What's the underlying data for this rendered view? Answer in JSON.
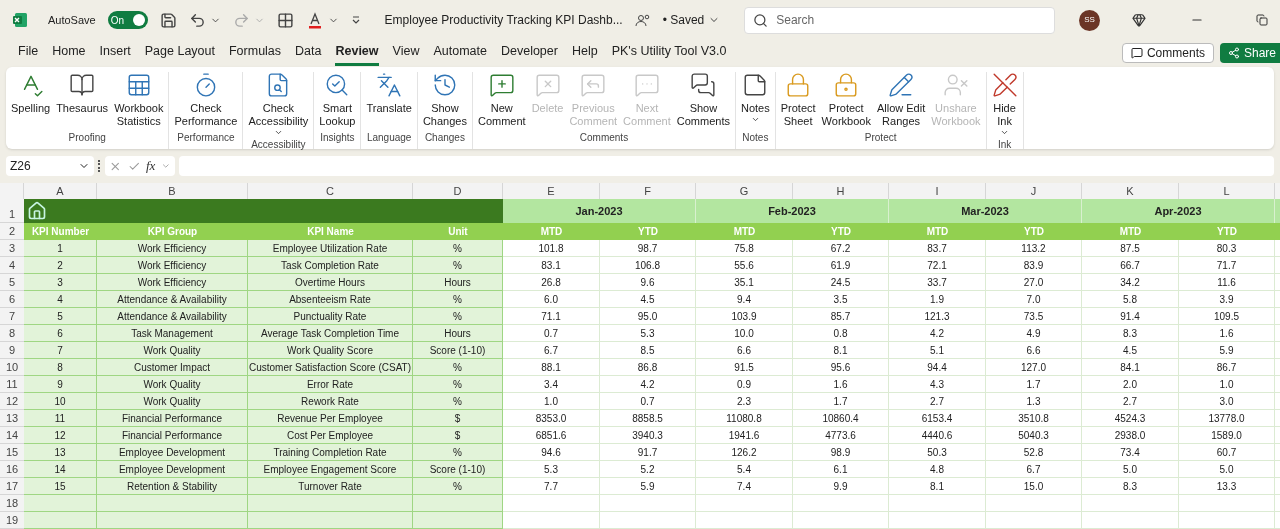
{
  "title_bar": {
    "autosave_label": "AutoSave",
    "autosave": {
      "on": true,
      "label": "On"
    },
    "document_title": "Employee Productivity Tracking KPI Dashb...",
    "save_status": "• Saved",
    "search_placeholder": "Search",
    "avatar_initials": "SS"
  },
  "menu": {
    "tabs": [
      {
        "label": "File",
        "selected": false
      },
      {
        "label": "Home",
        "selected": false
      },
      {
        "label": "Insert",
        "selected": false
      },
      {
        "label": "Page Layout",
        "selected": false
      },
      {
        "label": "Formulas",
        "selected": false
      },
      {
        "label": "Data",
        "selected": false
      },
      {
        "label": "Review",
        "selected": true
      },
      {
        "label": "View",
        "selected": false
      },
      {
        "label": "Automate",
        "selected": false
      },
      {
        "label": "Developer",
        "selected": false
      },
      {
        "label": "Help",
        "selected": false
      },
      {
        "label": "PK's Utility Tool V3.0",
        "selected": false
      }
    ],
    "comments_button": "Comments",
    "share_button": "Share"
  },
  "ribbon": {
    "groups": [
      {
        "label": "Proofing",
        "buttons": [
          {
            "lines": [
              "Spelling"
            ],
            "disabled": false,
            "dropdown": false
          },
          {
            "lines": [
              "Thesaurus"
            ],
            "disabled": false,
            "dropdown": false
          },
          {
            "lines": [
              "Workbook",
              "Statistics"
            ],
            "disabled": false,
            "dropdown": false
          }
        ]
      },
      {
        "label": "Performance",
        "buttons": [
          {
            "lines": [
              "Check",
              "Performance"
            ],
            "disabled": false,
            "dropdown": false
          }
        ]
      },
      {
        "label": "Accessibility",
        "buttons": [
          {
            "lines": [
              "Check",
              "Accessibility"
            ],
            "disabled": false,
            "dropdown": true
          }
        ]
      },
      {
        "label": "Insights",
        "buttons": [
          {
            "lines": [
              "Smart",
              "Lookup"
            ],
            "disabled": false,
            "dropdown": false
          }
        ]
      },
      {
        "label": "Language",
        "buttons": [
          {
            "lines": [
              "Translate"
            ],
            "disabled": false,
            "dropdown": false
          }
        ]
      },
      {
        "label": "Changes",
        "buttons": [
          {
            "lines": [
              "Show",
              "Changes"
            ],
            "disabled": false,
            "dropdown": false
          }
        ]
      },
      {
        "label": "Comments",
        "buttons": [
          {
            "lines": [
              "New",
              "Comment"
            ],
            "disabled": false,
            "dropdown": false
          },
          {
            "lines": [
              "Delete"
            ],
            "disabled": true,
            "dropdown": false
          },
          {
            "lines": [
              "Previous",
              "Comment"
            ],
            "disabled": true,
            "dropdown": false
          },
          {
            "lines": [
              "Next",
              "Comment"
            ],
            "disabled": true,
            "dropdown": false
          },
          {
            "lines": [
              "Show",
              "Comments"
            ],
            "disabled": false,
            "dropdown": false
          }
        ]
      },
      {
        "label": "Notes",
        "buttons": [
          {
            "lines": [
              "Notes"
            ],
            "disabled": false,
            "dropdown": true
          }
        ]
      },
      {
        "label": "Protect",
        "buttons": [
          {
            "lines": [
              "Protect",
              "Sheet"
            ],
            "disabled": false,
            "dropdown": false
          },
          {
            "lines": [
              "Protect",
              "Workbook"
            ],
            "disabled": false,
            "dropdown": false
          },
          {
            "lines": [
              "Allow Edit",
              "Ranges"
            ],
            "disabled": false,
            "dropdown": false
          },
          {
            "lines": [
              "Unshare",
              "Workbook"
            ],
            "disabled": true,
            "dropdown": false
          }
        ]
      },
      {
        "label": "Ink",
        "buttons": [
          {
            "lines": [
              "Hide",
              "Ink"
            ],
            "disabled": false,
            "dropdown": true
          }
        ]
      }
    ]
  },
  "formula_bar": {
    "name_box": "Z26",
    "function_label": "fx"
  },
  "sheet": {
    "column_letters": [
      "A",
      "B",
      "C",
      "D",
      "E",
      "F",
      "G",
      "H",
      "I",
      "J",
      "K",
      "L"
    ],
    "months": [
      "Jan-2023",
      "Feb-2023",
      "Mar-2023",
      "Apr-2023"
    ],
    "headers": [
      "KPI Number",
      "KPI Group",
      "KPI Name",
      "Unit",
      "MTD",
      "YTD",
      "MTD",
      "YTD",
      "MTD",
      "YTD",
      "MTD",
      "YTD"
    ],
    "rows": [
      [
        "1",
        "Work Efficiency",
        "Employee Utilization Rate",
        "%",
        "101.8",
        "98.7",
        "75.8",
        "67.2",
        "83.7",
        "113.2",
        "87.5",
        "80.3"
      ],
      [
        "2",
        "Work Efficiency",
        "Task Completion Rate",
        "%",
        "83.1",
        "106.8",
        "55.6",
        "61.9",
        "72.1",
        "83.9",
        "66.7",
        "71.7"
      ],
      [
        "3",
        "Work Efficiency",
        "Overtime Hours",
        "Hours",
        "26.8",
        "9.6",
        "35.1",
        "24.5",
        "33.7",
        "27.0",
        "34.2",
        "11.6"
      ],
      [
        "4",
        "Attendance & Availability",
        "Absenteeism Rate",
        "%",
        "6.0",
        "4.5",
        "9.4",
        "3.5",
        "1.9",
        "7.0",
        "5.8",
        "3.9"
      ],
      [
        "5",
        "Attendance & Availability",
        "Punctuality Rate",
        "%",
        "71.1",
        "95.0",
        "103.9",
        "85.7",
        "121.3",
        "73.5",
        "91.4",
        "109.5"
      ],
      [
        "6",
        "Task Management",
        "Average Task Completion Time",
        "Hours",
        "0.7",
        "5.3",
        "10.0",
        "0.8",
        "4.2",
        "4.9",
        "8.3",
        "1.6"
      ],
      [
        "7",
        "Work Quality",
        "Work Quality Score",
        "Score (1-10)",
        "6.7",
        "8.5",
        "6.6",
        "8.1",
        "5.1",
        "6.6",
        "4.5",
        "5.9"
      ],
      [
        "8",
        "Customer Impact",
        "Customer Satisfaction Score (CSAT)",
        "%",
        "88.1",
        "86.8",
        "91.5",
        "95.6",
        "94.4",
        "127.0",
        "84.1",
        "86.7"
      ],
      [
        "9",
        "Work Quality",
        "Error Rate",
        "%",
        "3.4",
        "4.2",
        "0.9",
        "1.6",
        "4.3",
        "1.7",
        "2.0",
        "1.0"
      ],
      [
        "10",
        "Work Quality",
        "Rework Rate",
        "%",
        "1.0",
        "0.7",
        "2.3",
        "1.7",
        "2.7",
        "1.3",
        "2.7",
        "3.0"
      ],
      [
        "11",
        "Financial Performance",
        "Revenue Per Employee",
        "$",
        "8353.0",
        "8858.5",
        "11080.8",
        "10860.4",
        "6153.4",
        "3510.8",
        "4524.3",
        "13778.0"
      ],
      [
        "12",
        "Financial Performance",
        "Cost Per Employee",
        "$",
        "6851.6",
        "3940.3",
        "1941.6",
        "4773.6",
        "4440.6",
        "5040.3",
        "2938.0",
        "1589.0"
      ],
      [
        "13",
        "Employee Development",
        "Training Completion Rate",
        "%",
        "94.6",
        "91.7",
        "126.2",
        "98.9",
        "50.3",
        "52.8",
        "73.4",
        "60.7"
      ],
      [
        "14",
        "Employee Development",
        "Employee Engagement Score",
        "Score (1-10)",
        "5.3",
        "5.2",
        "5.4",
        "6.1",
        "4.8",
        "6.7",
        "5.0",
        "5.0"
      ],
      [
        "15",
        "Retention & Stability",
        "Turnover Rate",
        "%",
        "7.7",
        "5.9",
        "7.4",
        "9.9",
        "8.1",
        "15.0",
        "8.3",
        "13.3"
      ]
    ],
    "row_numbers": [
      "1",
      "2",
      "3",
      "4",
      "5",
      "6",
      "7",
      "8",
      "9",
      "10",
      "11",
      "12",
      "13",
      "14",
      "15",
      "16",
      "17",
      "18",
      "19"
    ]
  }
}
